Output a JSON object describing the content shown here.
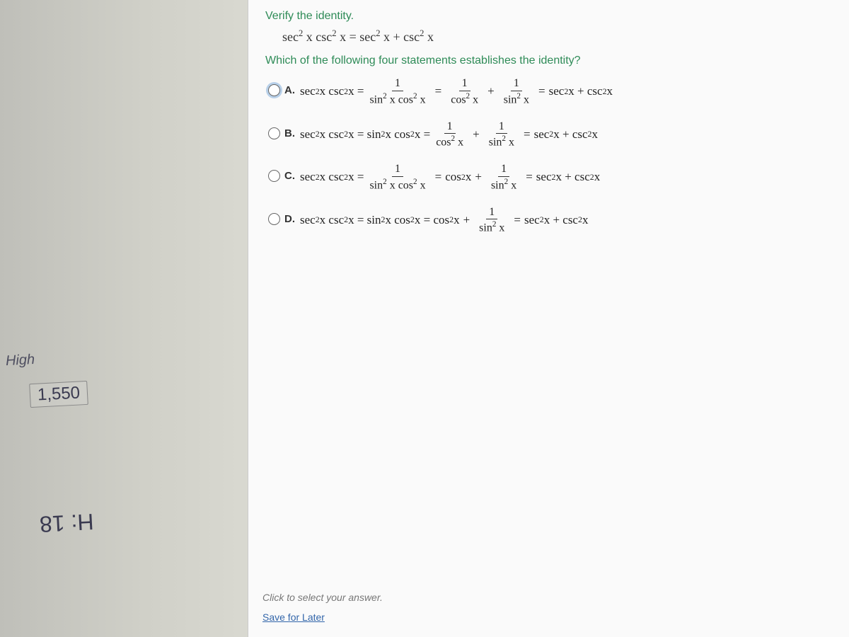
{
  "handwriting": {
    "h1": "High",
    "h2": "1,550",
    "h3": "H: 18"
  },
  "prompt": "Verify the identity.",
  "identity_html": "sec<sup>2</sup> x csc<sup>2</sup> x = sec<sup>2</sup> x + csc<sup>2</sup> x",
  "question": "Which of the following four statements establishes the identity?",
  "choices": {
    "A": {
      "label": "A.",
      "eq": "sec<sup>2</sup> x csc<sup>2</sup> x = <span class='frac'><span class='num'>1</span><span class='den'>sin<sup>2</sup> x cos<sup>2</sup> x</span></span> <span class='op'>=</span> <span class='frac'><span class='num'>1</span><span class='den'>cos<sup>2</sup> x</span></span> <span class='op'>+</span> <span class='frac'><span class='num'>1</span><span class='den'>sin<sup>2</sup> x</span></span> <span class='op'>=</span> sec<sup>2</sup> x + csc<sup>2</sup> x"
    },
    "B": {
      "label": "B.",
      "eq": "sec<sup>2</sup> x csc<sup>2</sup> x = sin<sup>2</sup> x cos<sup>2</sup> x = <span class='frac'><span class='num'>1</span><span class='den'>cos<sup>2</sup> x</span></span> <span class='op'>+</span> <span class='frac'><span class='num'>1</span><span class='den'>sin<sup>2</sup> x</span></span> <span class='op'>=</span> sec<sup>2</sup> x + csc<sup>2</sup> x"
    },
    "C": {
      "label": "C.",
      "eq": "sec<sup>2</sup> x csc<sup>2</sup> x = <span class='frac'><span class='num'>1</span><span class='den'>sin<sup>2</sup> x cos<sup>2</sup> x</span></span> <span class='op'>=</span> cos<sup>2</sup> x <span class='op'>+</span> <span class='frac'><span class='num'>1</span><span class='den'>sin<sup>2</sup> x</span></span> <span class='op'>=</span> sec<sup>2</sup> x + csc<sup>2</sup> x"
    },
    "D": {
      "label": "D.",
      "eq": "sec<sup>2</sup> x csc<sup>2</sup> x = sin<sup>2</sup> x cos<sup>2</sup> x = cos<sup>2</sup> x <span class='op'>+</span> <span class='frac'><span class='num'>1</span><span class='den'>sin<sup>2</sup> x</span></span> <span class='op'>=</span> sec<sup>2</sup> x + csc<sup>2</sup> x"
    }
  },
  "footer": {
    "click": "Click to select your answer.",
    "save": "Save for Later"
  }
}
